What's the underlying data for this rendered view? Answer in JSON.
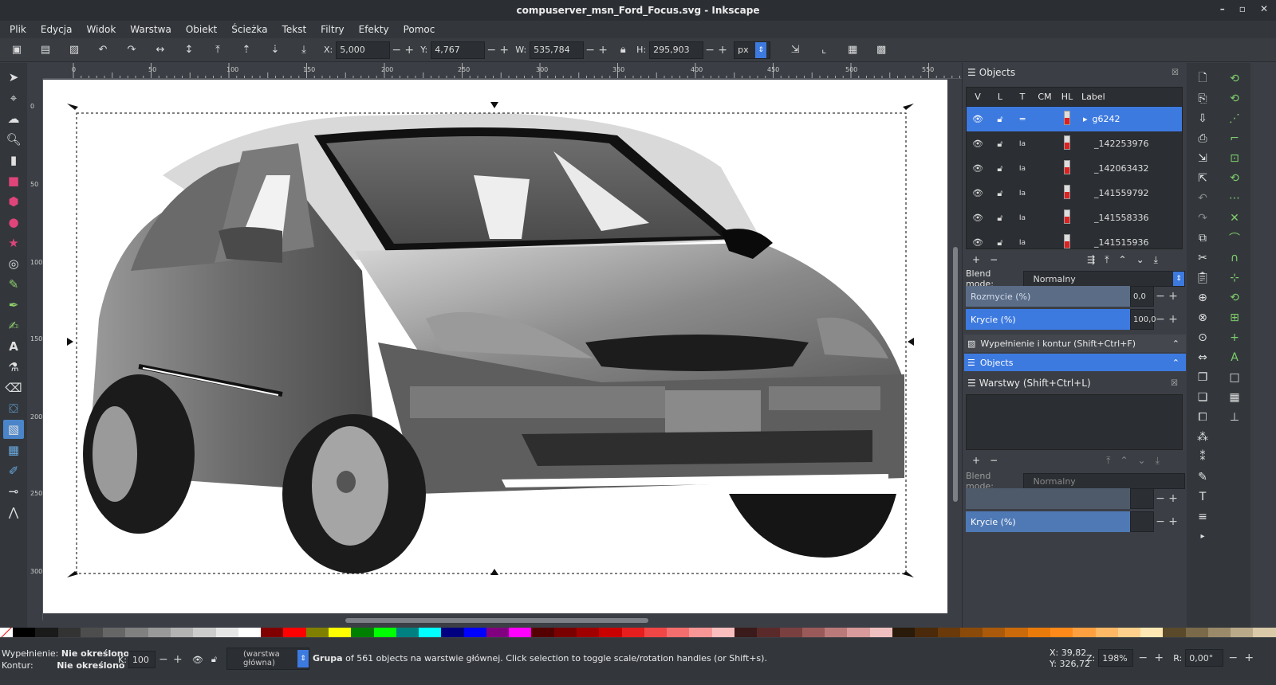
{
  "window": {
    "title": "compuserver_msn_Ford_Focus.svg - Inkscape",
    "controls": [
      "–",
      "▫",
      "✕"
    ]
  },
  "menu": [
    "Plik",
    "Edycja",
    "Widok",
    "Warstwa",
    "Obiekt",
    "Ścieżka",
    "Tekst",
    "Filtry",
    "Efekty",
    "Pomoc"
  ],
  "toolbar": {
    "x_label": "X:",
    "x_value": "5,000",
    "y_label": "Y:",
    "y_value": "4,767",
    "w_label": "W:",
    "w_value": "535,784",
    "h_label": "H:",
    "h_value": "295,903",
    "unit": "px"
  },
  "ruler": {
    "top_ticks": [
      "0",
      "50",
      "100",
      "150",
      "200",
      "250",
      "300",
      "350",
      "400",
      "450",
      "500",
      "550"
    ],
    "left_ticks": [
      "0",
      "50",
      "100",
      "150",
      "200",
      "250",
      "300"
    ]
  },
  "objects_panel": {
    "title": "Objects",
    "columns": [
      "V",
      "L",
      "T",
      "CM",
      "HL",
      "Label"
    ],
    "rows": [
      {
        "label": "g6242",
        "selected": true
      },
      {
        "label": "_142253976"
      },
      {
        "label": "_142063432"
      },
      {
        "label": "_141559792"
      },
      {
        "label": "_141558336"
      },
      {
        "label": "_141515936"
      }
    ],
    "blend_label": "Blend mode:",
    "blend_value": "Normalny",
    "blur_label": "Rozmycie (%)",
    "blur_value": "0,0",
    "opacity_label": "Krycie (%)",
    "opacity_value": "100,0"
  },
  "docks": {
    "fill_stroke": "Wypełnienie i kontur (Shift+Ctrl+F)",
    "objects": "Objects",
    "layers": "Warstwy (Shift+Ctrl+L)",
    "layers_blend_label": "Blend mode:",
    "layers_blend_value": "Normalny",
    "layers_opacity_label": "Krycie (%)"
  },
  "status": {
    "fill_label": "Wypełnienie:",
    "fill_value": "Nie określono",
    "stroke_label": "Kontur:",
    "stroke_value": "Nie określono",
    "k_label": "K:",
    "k_value": "100",
    "layer": "(warstwa główna)",
    "message_bold": "Grupa",
    "message_rest": " of 561 objects na warstwie głównej. Click selection to toggle scale/rotation handles (or Shift+s).",
    "x_coord": "X:   39,82",
    "y_coord": "Y:  326,72",
    "zoom_label": "Z:",
    "zoom_value": "198%",
    "rot_label": "R:",
    "rot_value": "0,00°"
  },
  "colors": {
    "accent": "#3d7ae0",
    "palette": [
      "#000000",
      "#1a1a1a",
      "#333333",
      "#4d4d4d",
      "#666666",
      "#808080",
      "#999999",
      "#b3b3b3",
      "#cccccc",
      "#e6e6e6",
      "#ffffff",
      "#800000",
      "#ff0000",
      "#808000",
      "#ffff00",
      "#008000",
      "#00ff00",
      "#008080",
      "#00ffff",
      "#000080",
      "#0000ff",
      "#800080",
      "#ff00ff",
      "#550000",
      "#7a0000",
      "#a00000",
      "#c80000",
      "#e61e1e",
      "#f04646",
      "#f46e6e",
      "#f89696",
      "#fbbebe",
      "#3a1a1a",
      "#5a2a2a",
      "#7a4040",
      "#9a5a5a",
      "#ba7a7a",
      "#d89a9a",
      "#f0c0c0",
      "#2a1a0a",
      "#4a2a0a",
      "#6a3a0a",
      "#8a4a0a",
      "#aa5a0a",
      "#ca6a0a",
      "#ea7a0a",
      "#ff8a1a",
      "#ffa040",
      "#ffb866",
      "#ffd08c",
      "#ffe8b3",
      "#5a4a2a",
      "#7a6a4a",
      "#9a8a6a",
      "#baaa8a",
      "#dacaaa"
    ]
  }
}
